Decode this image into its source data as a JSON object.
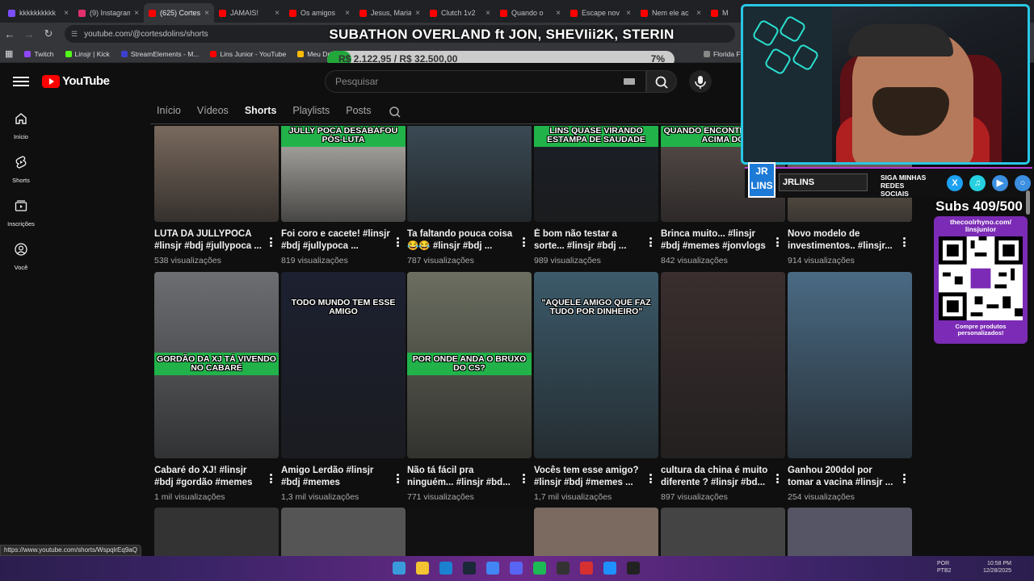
{
  "browser": {
    "tabs": [
      {
        "title": "kkkkkkkkkk",
        "color": "#7c4dff",
        "active": false
      },
      {
        "title": "(9) Instagram",
        "color": "#e1306c",
        "active": false
      },
      {
        "title": "(625) Cortes",
        "color": "#ff0000",
        "active": true
      },
      {
        "title": "JAMAIS!",
        "color": "#ff0000",
        "active": false
      },
      {
        "title": "Os amigos",
        "color": "#ff0000",
        "active": false
      },
      {
        "title": "Jesus, Maria",
        "color": "#ff0000",
        "active": false
      },
      {
        "title": "Clutch 1v2",
        "color": "#ff0000",
        "active": false
      },
      {
        "title": "Quando o",
        "color": "#ff0000",
        "active": false
      },
      {
        "title": "Escape nov",
        "color": "#ff0000",
        "active": false
      },
      {
        "title": "Nem ele ac",
        "color": "#ff0000",
        "active": false
      },
      {
        "title": "M",
        "color": "#ff0000",
        "active": false
      }
    ],
    "url": "youtube.com/@cortesdolins/shorts",
    "bookmarks": [
      {
        "label": "Twitch",
        "color": "#9146ff"
      },
      {
        "label": "Linsjr | Kick",
        "color": "#53fc18"
      },
      {
        "label": "StreamElements - M...",
        "color": "#3d3fd1"
      },
      {
        "label": "Lins Junior - YouTube",
        "color": "#ff0000"
      },
      {
        "label": "Meu Drive",
        "color": "#fbbc04"
      },
      {
        "label": "Florida FWC",
        "color": "#888888"
      }
    ]
  },
  "overlay": {
    "title": "SUBATHON OVERLAND ft JON, SHEVIii2K, STERIN",
    "progress_text": "R$ 2.122,95 / R$ 32.500,00",
    "progress_pct_label": "7%",
    "progress_fraction": 0.07
  },
  "youtube": {
    "logo": "YouTube",
    "search_placeholder": "Pesquisar",
    "sidebar": [
      {
        "label": "Início",
        "icon": "home-icon"
      },
      {
        "label": "Shorts",
        "icon": "shorts-icon"
      },
      {
        "label": "Inscrições",
        "icon": "subscriptions-icon"
      },
      {
        "label": "Você",
        "icon": "you-icon"
      }
    ],
    "channel_tabs": [
      {
        "label": "Início",
        "active": false
      },
      {
        "label": "Vídeos",
        "active": false
      },
      {
        "label": "Shorts",
        "active": true
      },
      {
        "label": "Playlists",
        "active": false
      },
      {
        "label": "Posts",
        "active": false
      }
    ]
  },
  "shorts_rows": [
    [
      {
        "title": "LUTA DA JULLYPOCA #linsjr #bdj #jullypoca ...",
        "views": "538 visualizações",
        "caption": "",
        "bg": "#7a6a5e"
      },
      {
        "title": "Foi coro e cacete! #linsjr #bdj #jullypoca ...",
        "views": "819 visualizações",
        "caption": "JULLY POCA DESABAFOU PÓS-LUTA",
        "bg": "#b8b6b0"
      },
      {
        "title": "Ta faltando pouca coisa 😂😂 #linsjr #bdj ...",
        "views": "787 visualizações",
        "caption": "",
        "bg": "#3a4a55"
      },
      {
        "title": "É bom não testar a sorte... #linsjr #bdj ...",
        "views": "989 visualizações",
        "caption": "LINS QUASE VIRANDO ESTAMPA DE SAUDADE",
        "bg": "#1b1f27"
      },
      {
        "title": "Brinca muito... #linsjr #bdj #memes #jonvlogs",
        "views": "842 visualizações",
        "caption": "QUANDO ENCONTRA AMIGO ACIMA DO",
        "bg": "#5a4f4c"
      },
      {
        "title": "Novo modelo de investimentos.. #linsjr...",
        "views": "914 visualizações",
        "caption": "",
        "bg": "#8a7a6a"
      }
    ],
    [
      {
        "title": "Cabaré do XJ! #linsjr #bdj #gordão #memes",
        "views": "1 mil visualizações",
        "caption": "GORDÃO DA XJ TÁ VIVENDO NO CABARÉ",
        "bg": "#6c6e72"
      },
      {
        "title": "Amigo Lerdão #linsjr #bdj #memes",
        "views": "1,3 mil visualizações",
        "caption": "TODO MUNDO TEM ESSE AMIGO",
        "bg": "#1c2030"
      },
      {
        "title": "Não tá fácil pra ninguém... #linsjr #bd...",
        "views": "771 visualizações",
        "caption": "POR ONDE ANDA O BRUXO DO CS?",
        "bg": "#6b6e60"
      },
      {
        "title": "Vocês tem esse amigo? #linsjr #bdj #memes ...",
        "views": "1,7 mil visualizações",
        "caption": "\"AQUELE AMIGO QUE FAZ TUDO POR DINHEIRO\"",
        "bg": "#3c5a6a"
      },
      {
        "title": "cultura da china é muito diferente ? #linsjr #bd...",
        "views": "897 visualizações",
        "caption": "",
        "bg": "#3a2e2e"
      },
      {
        "title": "Ganhou 200dol por tomar a vacina #linsjr ...",
        "views": "254 visualizações",
        "caption": "",
        "bg": "#4a6a84"
      }
    ]
  ],
  "bottom_row_colors": [
    "#333",
    "#555",
    "#111",
    "#7a6a60",
    "#444",
    "#556"
  ],
  "stream": {
    "name": "JRLINS",
    "jr_logo": "JR LINS",
    "siga": "SIGA MINHAS REDES SOCIAIS",
    "subs": "Subs 409/500",
    "qr_url": "thecoolrhyno.com/ linsjunior",
    "qr_promo": "Compre produtos personalizados!"
  },
  "status_url": "https://www.youtube.com/shorts/WspqlrEq9aQ",
  "taskbar": {
    "lang": "POR PTB2",
    "time": "10:58 PM",
    "date": "12/28/2025"
  }
}
